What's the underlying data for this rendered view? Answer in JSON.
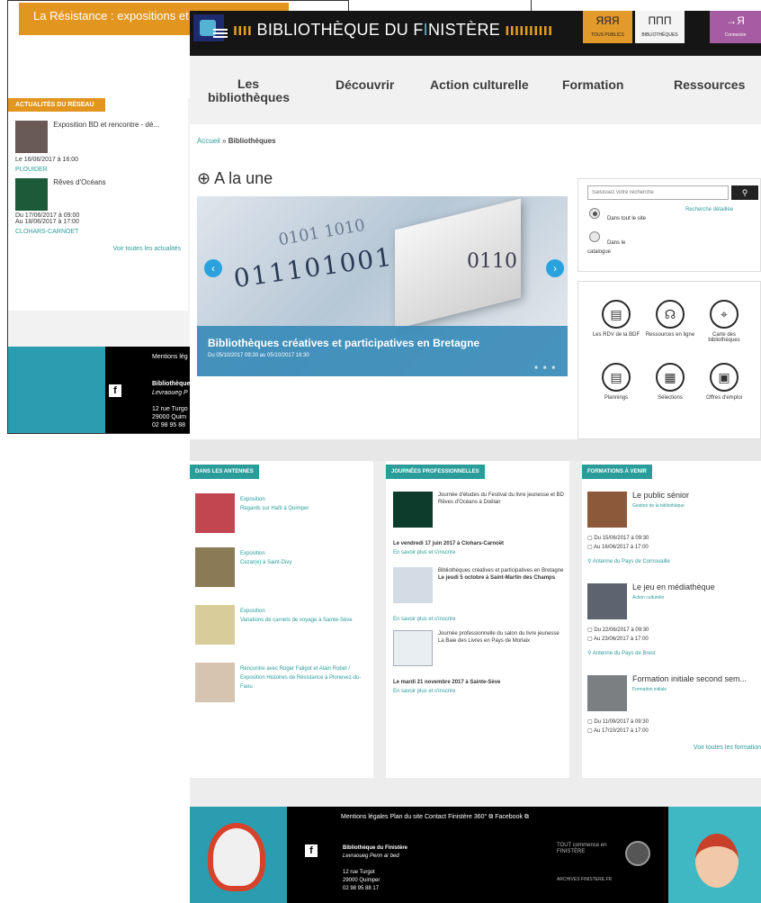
{
  "back": {
    "banner": "La Résistance : expositions et",
    "side_title": "ACTUALITÉS DU RÉSEAU",
    "items": [
      {
        "title": "Exposition BD et rencontre - dé...",
        "date": "Le 16/06/2017 à 16:00",
        "place": "PLOUIDER"
      },
      {
        "title": "Rêves d'Océans",
        "date": "Du 17/06/2017 à 09:00",
        "date2": "Au 18/06/2017 à 17:00",
        "place": "CLOHARS-CARNOET"
      }
    ],
    "see_all": "Voir toutes les actualités",
    "footer_mentions": "Mentions lég",
    "footer_name": "Bibliothèque",
    "footer_name2": "Levraoueg P",
    "footer_addr1": "12 rue Turgo",
    "footer_addr2": "29000 Quim",
    "footer_addr3": "02 98 95 88"
  },
  "header": {
    "site_title_main": "BIBLIOTHÈQUE DU F",
    "site_title_i": "I",
    "site_title_end": "NISTÈRE",
    "btn_public_icon": "ЯЯЯ",
    "btn_public": "TOUS PUBLICS",
    "btn_bib_icon": "ΠΠΠ",
    "btn_bib": "BIBLIOTHÈQUES",
    "btn_login_icon": "→Я",
    "btn_login": "Connexion"
  },
  "nav": {
    "items": [
      "Les bibliothèques",
      "Découvrir",
      "Action culturelle",
      "Formation",
      "Ressources"
    ]
  },
  "breadcrumb": {
    "home": "Accueil",
    "sep": "»",
    "current": "Bibliothèques"
  },
  "une": {
    "title": "A la une",
    "caption_title": "Bibliothèques créatives et participatives en Bretagne",
    "caption_date": "Du 05/10/2017 09:30 au 05/10/2017 16:30"
  },
  "search": {
    "placeholder": "Saisissez votre recherche",
    "opt1": "Dans tout le site",
    "opt2": "Dans le catalogue",
    "advanced": "Recherche détaillée"
  },
  "quick": {
    "items": [
      "Les RDV de la BDF",
      "Ressources en ligne",
      "Carte des bibliothèques",
      "Plannings",
      "Sélections",
      "Offres d'emploi"
    ]
  },
  "antennes": {
    "head": "DANS LES ANTENNES",
    "items": [
      {
        "type": "Exposition",
        "text": "Regards sur Haïti à Quimper"
      },
      {
        "type": "Exposition",
        "text": "Cezar(e) à Saint-Divy"
      },
      {
        "type": "Exposition",
        "text": "Variations de carnets de voyage à Sainte-Sève"
      },
      {
        "type": "Rencontre avec Roger Faligot et",
        "text": "Alain Robet / Exposition Histoires de Résistance à Plonevez-du-Faou"
      }
    ]
  },
  "journees": {
    "head": "JOURNÉES PROFESSIONNELLES",
    "items": [
      {
        "text": "Journée d'études du Festival du livre jeunesse et BD Rêves d'Océans à Doëlan",
        "date": "Le vendredi 17 juin 2017 à Clohars-Carnoët",
        "more": "En savoir plus et s'inscrire"
      },
      {
        "text": "Bibliothèques créatives et participatives en Bretagne",
        "text2": "Le jeudi 5 octobre à Saint-Martin des Champs",
        "more": "En savoir plus et s'inscrire"
      },
      {
        "text": "Journée professionnelle du salon du livre jeunesse La Baie des Livres en Pays de Morlaix",
        "date": "Le mardi 21 novembre 2017 à Sainte-Sève",
        "more": "En savoir plus et s'inscrire"
      }
    ]
  },
  "formations": {
    "head": "FORMATIONS À VENIR",
    "items": [
      {
        "title": "Le public sénior",
        "cat": "Gestion de la bibliothèque",
        "d1": "Du 15/06/2017 à 09:30",
        "d2": "Au 16/06/2017 à 17:00",
        "loc": "Antenne du Pays de Cornouaille"
      },
      {
        "title": "Le jeu en médiathèque",
        "cat": "Action culturelle",
        "d1": "Du 22/06/2017 à 09:30",
        "d2": "Au 23/06/2017 à 17:00",
        "loc": "Antenne du Pays de Brest"
      },
      {
        "title": "Formation initiale second sem...",
        "cat": "Formation initiale",
        "d1": "Du 11/09/2017 à 09:30",
        "d2": "Au 17/10/2017 à 17:00",
        "loc": ""
      }
    ],
    "see_all": "Voir toutes les formation"
  },
  "footer": {
    "links": "Mentions légales   Plan du site   Contact   Finistère 360° ⧉   Facebook ⧉",
    "name": "Bibliothèque du Finistère",
    "name_br": "Levraoueg Penn ar bed",
    "addr1": "12 rue Turgot",
    "addr2": "29000 Quimper",
    "addr3": "02 98 95 88 17",
    "tout": "TOUT commence en FINISTÈRE",
    "archives": "ARCHIVES FINISTERE.FR"
  }
}
